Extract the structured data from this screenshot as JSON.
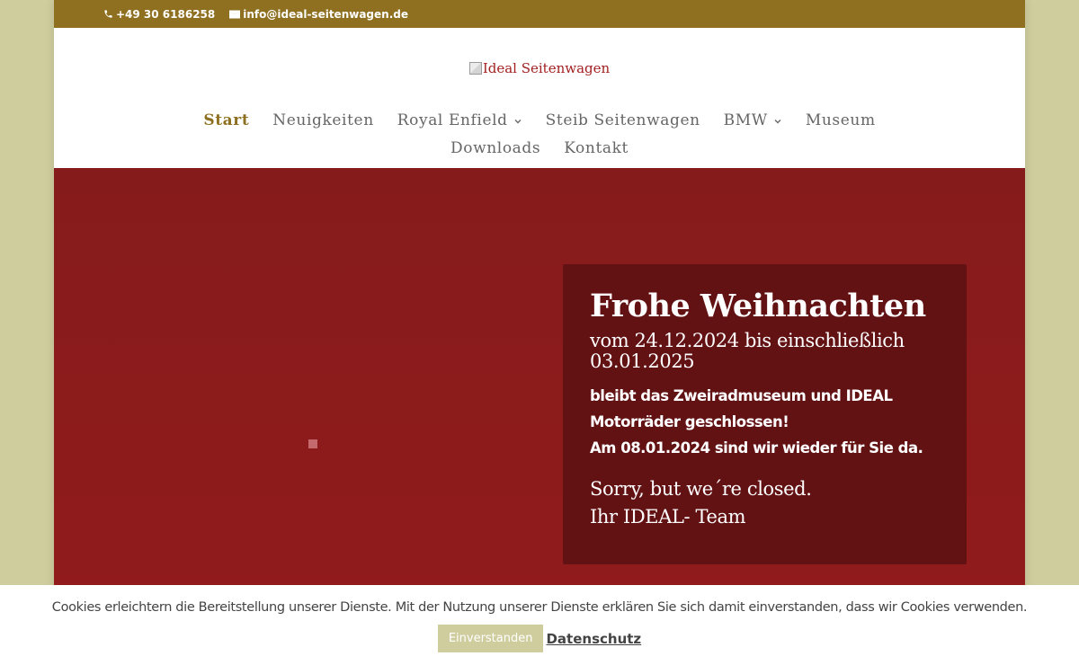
{
  "topbar": {
    "phone": "+49 30 6186258",
    "email": "info@ideal-seitenwagen.de"
  },
  "logo": {
    "alt_text": "Ideal Seitenwagen"
  },
  "nav": {
    "row1": [
      {
        "label": "Start",
        "active": true,
        "has_submenu": false
      },
      {
        "label": "Neuigkeiten",
        "active": false,
        "has_submenu": false
      },
      {
        "label": "Royal Enfield",
        "active": false,
        "has_submenu": true
      },
      {
        "label": "Steib Seitenwagen",
        "active": false,
        "has_submenu": false
      },
      {
        "label": "BMW",
        "active": false,
        "has_submenu": true
      },
      {
        "label": "Museum",
        "active": false,
        "has_submenu": false
      }
    ],
    "row2": [
      {
        "label": "Downloads",
        "active": false,
        "has_submenu": false
      },
      {
        "label": "Kontakt",
        "active": false,
        "has_submenu": false
      }
    ]
  },
  "notice": {
    "title": "Frohe Weihnachten",
    "subtitle": "vom 24.12.2024 bis einschließlich 03.01.2025",
    "body_line1": "bleibt das Zweiradmuseum und IDEAL Motorräder geschlossen!",
    "body_line2": "Am 08.01.2024 sind wir wieder für Sie da.",
    "closing_line1": "Sorry, but we´re closed.",
    "closing_line2": "Ihr IDEAL- Team"
  },
  "cookie_banner": {
    "message": "Cookies erleichtern die Bereitstellung unserer Dienste. Mit der Nutzung unserer Dienste erklären Sie sich damit einverstanden, dass wir Cookies verwenden.",
    "accept_label": "Einverstanden",
    "privacy_label": "Datenschutz"
  },
  "colors": {
    "accent": "#8e7020",
    "hero_bg": "#8e1b1c",
    "card_bg": "#631214",
    "outer_bg": "#cfcd9e"
  },
  "icons": {
    "phone": "phone-icon",
    "email": "envelope-icon",
    "submenu": "chevron-down-icon",
    "logo_placeholder": "broken-image-icon"
  }
}
